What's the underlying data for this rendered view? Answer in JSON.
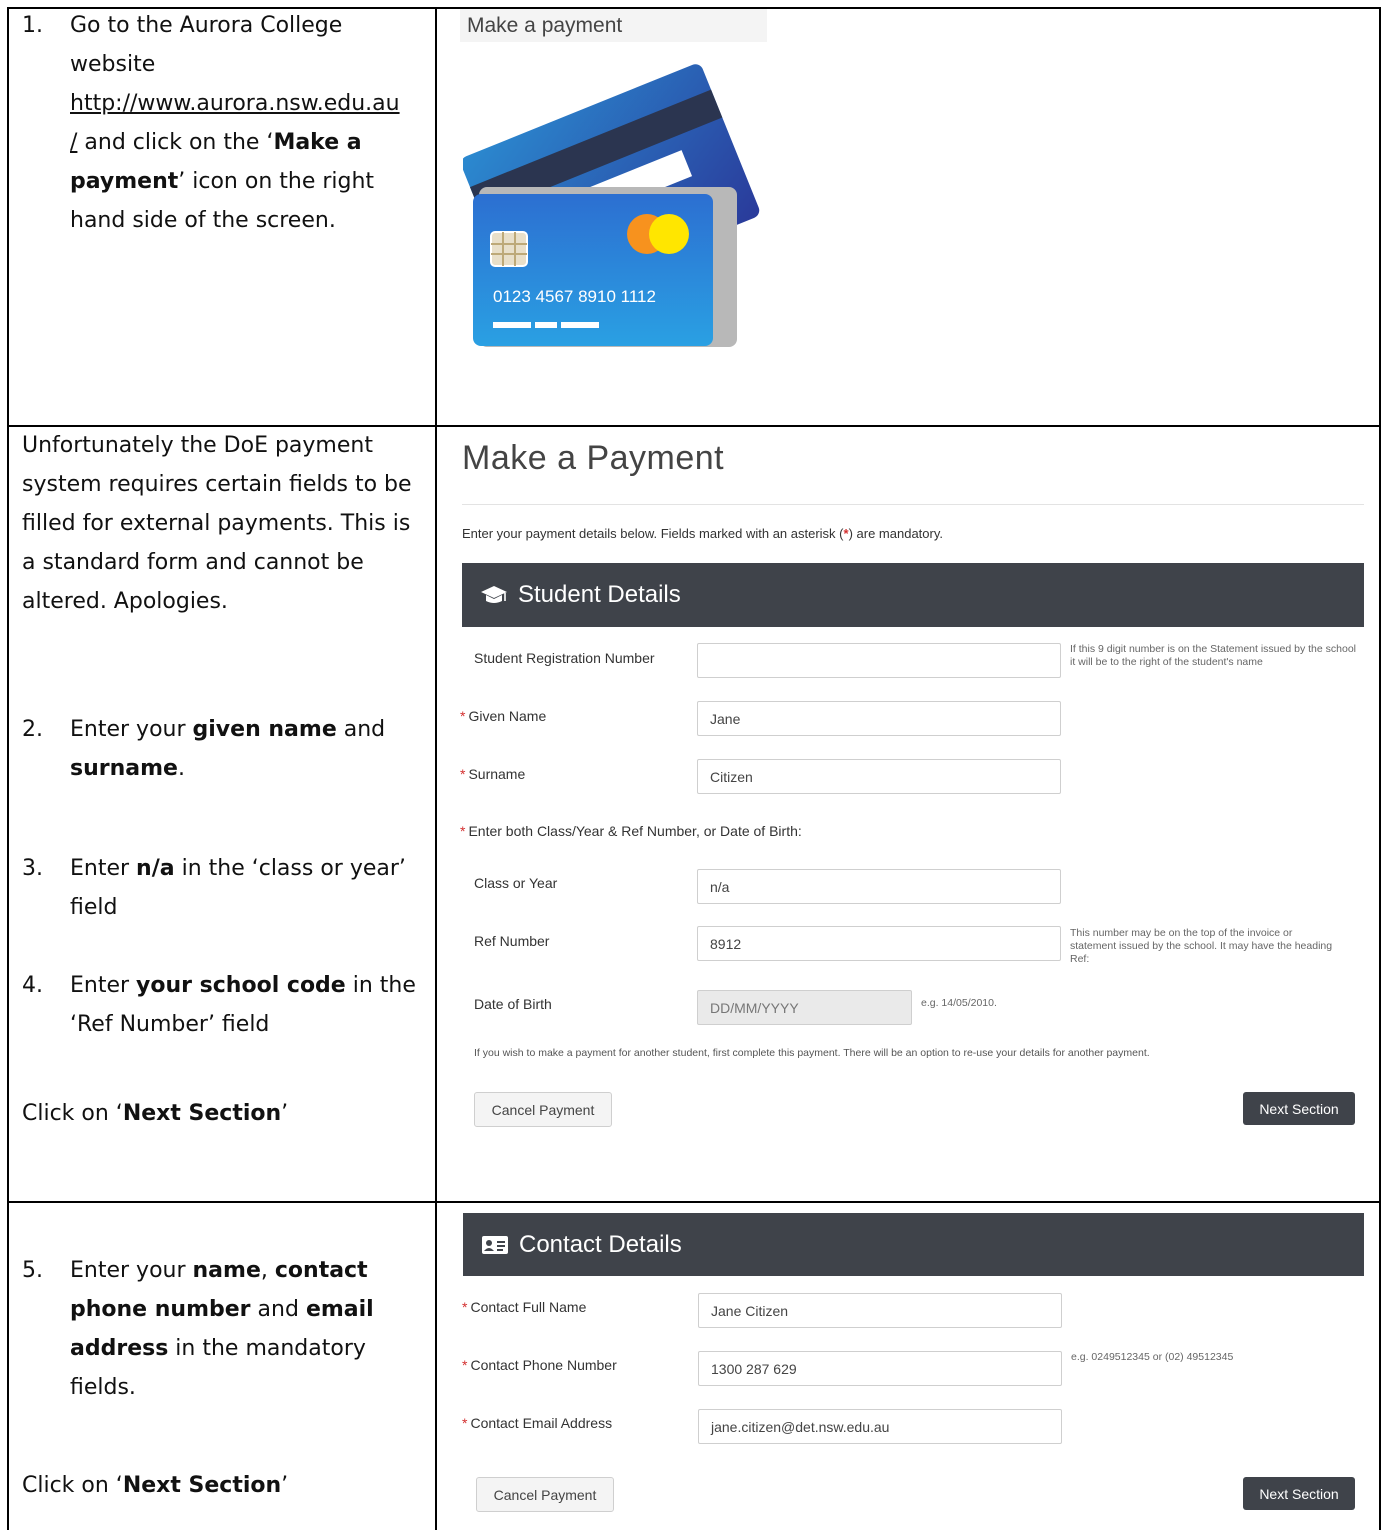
{
  "row1": {
    "step_num": "1.",
    "text_pre": "Go to the Aurora College website",
    "link": "http://www.aurora.nsw.edu.au/",
    "link_part1": "http://www.aurora.nsw.edu.au",
    "link_part2": "/",
    "text_mid": " and click on the ‘",
    "bold1": "Make a payment",
    "bold1_a": "Make a",
    "bold1_b": "payment",
    "text_post_a": "’ icon on the right",
    "text_post_b": "hand side of the screen.",
    "panel_label": "Make a payment",
    "card_number": "0123  4567  8910  1112"
  },
  "row2": {
    "intro_lines": [
      "Unfortunately the DoE payment",
      "system requires certain fields to be",
      "filled for external payments. This is",
      "a standard form and cannot be",
      "altered. Apologies."
    ],
    "step2_num": "2.",
    "step2_pre": "Enter your ",
    "step2_bold1": "given name",
    "step2_mid": " and",
    "step2_bold2": "surname",
    "step2_post": ".",
    "step3_num": "3.",
    "step3_pre": "Enter ",
    "step3_bold": "n/a",
    "step3_post": " in the ‘class or year’",
    "step3_line2": "field",
    "step4_num": "4.",
    "step4_pre": "Enter ",
    "step4_bold": "your school code",
    "step4_post": " in the",
    "step4_line2": "‘Ref Number’ field",
    "click_pre": "Click on ‘",
    "click_bold": "Next Section",
    "click_post": "’",
    "form": {
      "title": "Make a Payment",
      "intro_pre": "Enter your payment details below. Fields marked with an asterisk (",
      "intro_star": "*",
      "intro_post": ") are mandatory.",
      "section_title": "Student Details",
      "srn_label": "Student Registration Number",
      "srn_value": "",
      "srn_hint": "If this 9 digit number is on the Statement issued by the school it will be to the right of the student's name",
      "given_label": "Given Name",
      "given_value": "Jane",
      "surname_label": "Surname",
      "surname_value": "Citizen",
      "either_label": "Enter both Class/Year & Ref Number, or Date of Birth:",
      "class_label": "Class or Year",
      "class_value": "n/a",
      "ref_label": "Ref Number",
      "ref_value": "8912",
      "ref_hint": "This number may be on the top of the invoice or statement issued by the school. It may have the heading Ref:",
      "dob_label": "Date of Birth",
      "dob_placeholder": "DD/MM/YYYY",
      "dob_hint": "e.g. 14/05/2010.",
      "note": "If you wish to make a payment for another student, first complete this payment. There will be an option to re-use your details for another payment.",
      "cancel_label": "Cancel Payment",
      "next_label": "Next Section"
    }
  },
  "row3": {
    "step5_num": "5.",
    "step5_pre": "Enter your ",
    "step5_b1": "name",
    "step5_c1": ", ",
    "step5_b2": "contact",
    "step5_b3": "phone number",
    "step5_c2": " and ",
    "step5_b4": "email",
    "step5_b5": "address",
    "step5_c3": " in the mandatory",
    "step5_c4": "fields.",
    "click_pre": "Click on ‘",
    "click_bold": "Next Section",
    "click_post": "’",
    "form": {
      "section_title": "Contact Details",
      "name_label": "Contact Full Name",
      "name_value": "Jane Citizen",
      "phone_label": "Contact Phone Number",
      "phone_value": "1300 287 629",
      "phone_hint": "e.g. 0249512345 or (02) 49512345",
      "email_label": "Contact Email Address",
      "email_value": "jane.citizen@det.nsw.edu.au",
      "cancel_label": "Cancel Payment",
      "next_label": "Next Section"
    }
  }
}
